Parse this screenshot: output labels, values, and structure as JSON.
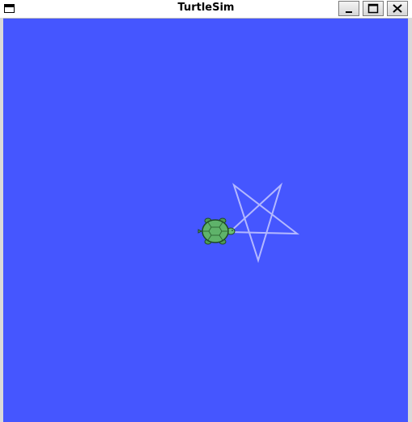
{
  "window": {
    "title": "TurtleSim",
    "controls": {
      "minimize_icon": "minimize-icon",
      "maximize_icon": "maximize-icon",
      "close_icon": "close-icon"
    }
  },
  "canvas": {
    "background_color": "#4556ff",
    "pen_color": "#b3b8ff",
    "turtle_icon": "turtle-icon",
    "turtle_color": "#5fb36a"
  }
}
